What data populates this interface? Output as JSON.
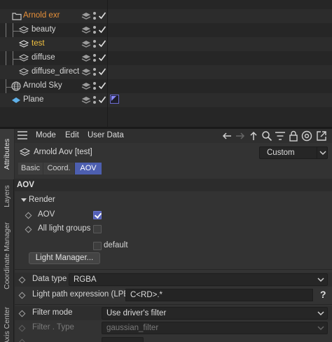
{
  "object_manager": {
    "objects": [
      {
        "name": "Arnold exr",
        "color": "#e8913a"
      },
      {
        "name": "beauty"
      },
      {
        "name": "test",
        "color": "#f0c040"
      },
      {
        "name": "diffuse"
      },
      {
        "name": "diffuse_direct"
      },
      {
        "name": "Arnold Sky"
      },
      {
        "name": "Plane"
      }
    ]
  },
  "side_tabs": [
    "Attributes",
    "Layers",
    "Coordinate Manager",
    "Axis Center"
  ],
  "attributes": {
    "menu": [
      "Mode",
      "Edit",
      "User Data"
    ],
    "title": "Arnold Aov [test]",
    "preset": "Custom",
    "tabs": [
      "Basic",
      "Coord.",
      "AOV"
    ],
    "section": "AOV",
    "group": "Render",
    "params": {
      "aov_label": "AOV",
      "all_light_groups_label": "All light groups",
      "default_label": "default",
      "light_manager_button": "Light Manager...",
      "data_type_label": "Data type",
      "data_type_value": "RGBA",
      "lpe_label": "Light path expression (LPE)",
      "lpe_value": "C<RD>.*",
      "lpe_help": "?",
      "filter_mode_label": "Filter mode",
      "filter_mode_value": "Use driver's filter",
      "filter_type_label": "Filter . Type",
      "filter_type_value": "gaussian_filter"
    }
  },
  "colors": {
    "accent": "#4d5fb0",
    "checked": "#5460b8",
    "orange": "#e8913a",
    "yellow": "#f0c040"
  }
}
